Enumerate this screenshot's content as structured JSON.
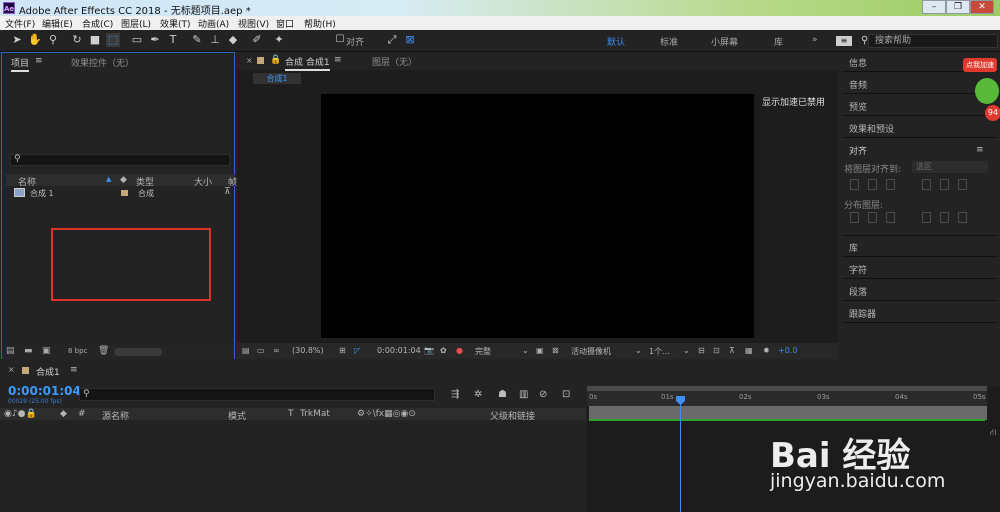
{
  "window": {
    "title": "Adobe After Effects CC 2018 - 无标题项目.aep *",
    "logo_text": "Ae",
    "buttons": [
      "–",
      "❐",
      "✕"
    ]
  },
  "menu": [
    "文件(F)",
    "编辑(E)",
    "合成(C)",
    "图层(L)",
    "效果(T)",
    "动画(A)",
    "视图(V)",
    "窗口",
    "帮助(H)"
  ],
  "toolbar": {
    "snap_label": "对齐",
    "workspaces": [
      "默认",
      "标准",
      "小屏幕",
      "库"
    ],
    "workspace_more": "»",
    "search_placeholder": "搜索帮助"
  },
  "project_panel": {
    "tab_project": "项目",
    "tab_effects": "效果控件（无）",
    "columns": [
      "名称",
      "类型",
      "大小",
      "帧"
    ],
    "rows": [
      {
        "name": "合成 1",
        "type": "合成"
      }
    ],
    "bpc": "8 bpc"
  },
  "comp_panel": {
    "tab_comp": "合成 合成1",
    "tab_layer": "图层（无）",
    "subtab": "合成1",
    "accel_note": "显示加速已禁用",
    "zoom": "(30.8%)",
    "timecode": "0:00:01:04",
    "resolution": "完整",
    "camera": "活动摄像机",
    "views": "1个...",
    "exposure": "+0.0"
  },
  "right_panel": {
    "items": [
      "信息",
      "音频",
      "预览",
      "效果和预设"
    ],
    "align_title": "对齐",
    "align_to_label": "将图层对齐到:",
    "align_to_value": "选区",
    "distribute_label": "分布图层:",
    "lower_items": [
      "库",
      "字符",
      "段落",
      "跟踪器"
    ]
  },
  "timeline": {
    "tab": "合成1",
    "timecode": "0:00:01:04",
    "frames": "00029 (25.00 fps)",
    "columns": [
      "源名称",
      "模式",
      "T",
      "TrkMat",
      "父级和链接"
    ],
    "ruler": [
      "0s",
      "01s",
      "02s",
      "03s",
      "04s",
      "05s"
    ]
  },
  "promo": {
    "label": "点我加速",
    "number": "94"
  },
  "watermark": {
    "text": "Bai 经验",
    "url": "jingyan.baidu.com"
  }
}
